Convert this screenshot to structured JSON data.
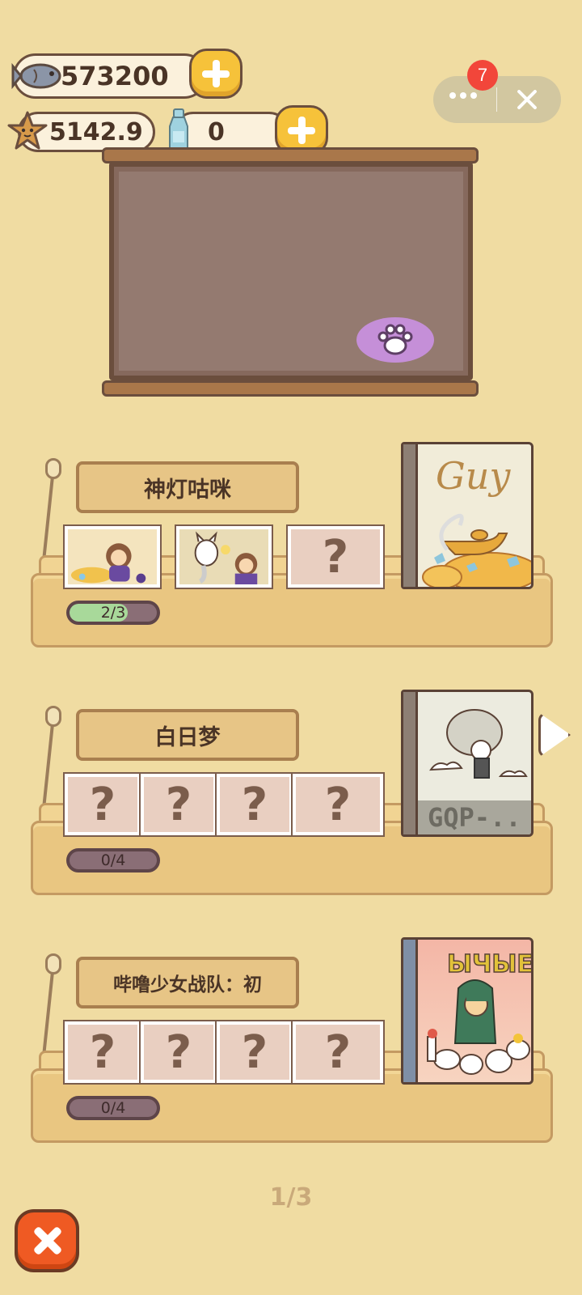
{
  "currencies": {
    "fish": {
      "icon": "fish-icon",
      "value": "573200"
    },
    "star": {
      "icon": "starfish-icon",
      "value": "5142.9"
    },
    "bottle": {
      "icon": "bottle-icon",
      "value": "0"
    }
  },
  "capsule": {
    "badge_count": "7"
  },
  "shelves": [
    {
      "title": "神灯咕咪",
      "progress": "2/3",
      "progress_fraction": 0.667,
      "cards": [
        "filled",
        "filled",
        "?"
      ],
      "book_icon": "magic-lamp-book-icon",
      "book_title": "Guy"
    },
    {
      "title": "白日梦",
      "progress": "0/4",
      "progress_fraction": 0,
      "cards": [
        "?",
        "?",
        "?",
        "?"
      ],
      "book_icon": "daydream-book-icon",
      "book_title": "GQP-.."
    },
    {
      "title": "哔噜少女战队：初",
      "progress": "0/4",
      "progress_fraction": 0,
      "cards": [
        "?",
        "?",
        "?",
        "?"
      ],
      "book_icon": "girls-squad-book-icon",
      "book_title": ""
    }
  ],
  "pager": "1/3",
  "colors": {
    "background": "#f0dca2",
    "accent": "#f6c23a",
    "exit": "#ef5a23",
    "paw": "#c58fd8"
  }
}
